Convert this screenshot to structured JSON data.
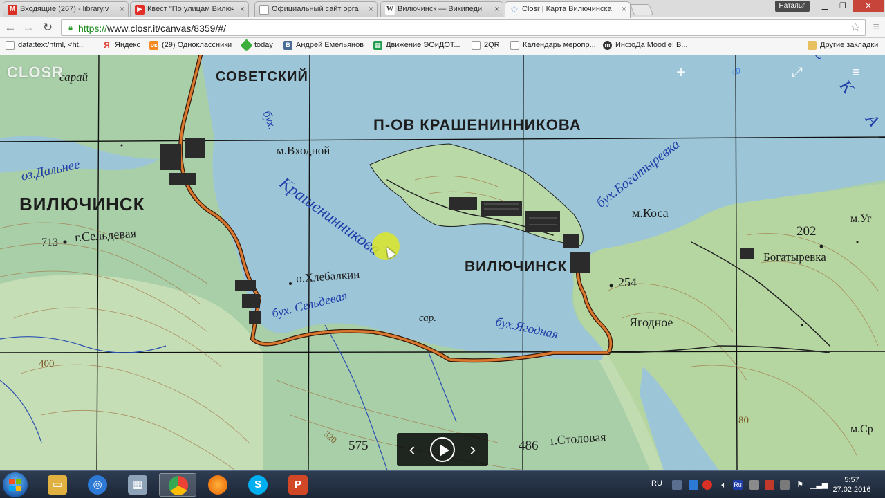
{
  "browser": {
    "tabs": [
      {
        "label": "Входящие (267) - library.v",
        "icon": "gmail-icon",
        "icon_color": "#d93025"
      },
      {
        "label": "Квест \"По улицам Вилюч",
        "icon": "youtube-icon",
        "icon_color": "#e52d27"
      },
      {
        "label": "Официальный сайт орга",
        "icon": "page-icon",
        "icon_color": "#888888"
      },
      {
        "label": "Вилючинск — Википеди",
        "icon": "wikipedia-icon",
        "icon_color": "#555555"
      },
      {
        "label": "Closr | Карта Вилючинска",
        "icon": "closr-star-icon",
        "icon_color": "#7aa7d8"
      }
    ],
    "user_name": "Наталья",
    "url_scheme": "https://",
    "url_rest": "www.closr.it/canvas/8359/#/",
    "bookmarks": [
      {
        "label": "data:text/html, <ht...",
        "icon": "page-icon",
        "color": "#888888"
      },
      {
        "label": "Яндекс",
        "icon": "yandex-icon",
        "color": "#e03b30"
      },
      {
        "label": "(29) Одноклассники",
        "icon": "odnoklassniki-icon",
        "color": "#f48a1f"
      },
      {
        "label": "today",
        "icon": "today-icon",
        "color": "#3cae3c"
      },
      {
        "label": "Андрей Емельянов",
        "icon": "vk-icon",
        "color": "#4a6d96"
      },
      {
        "label": "Движение ЭОиДОТ...",
        "icon": "sheets-icon",
        "color": "#1f9e4e"
      },
      {
        "label": "2QR",
        "icon": "page-icon",
        "color": "#888888"
      },
      {
        "label": "Календарь меропр...",
        "icon": "page-icon",
        "color": "#888888"
      },
      {
        "label": "ИнфоДа Moodle: В...",
        "icon": "moodle-icon",
        "color": "#333333"
      }
    ],
    "other_bookmarks": "Другие закладки"
  },
  "closr": {
    "logo": "CLOSR",
    "counter": "0"
  },
  "map_labels": {
    "sovetsky": "СОВЕТСКИЙ",
    "saray": "сарай",
    "peninsula": "П-ОВ КРАШЕНИННИКОВА",
    "m_vkhodnoy": "м.Входной",
    "oz_dalnee": "оз.Дальнее",
    "vilyuchinsk_w": "ВИЛЮЧИНСК",
    "elev_713": "713",
    "g_seldevaya": "г.Сельдевая",
    "bukh": "бух.",
    "krasheninnikova": "Крашенинникова",
    "vilyuchinsk_e": "ВИЛЮЧИНСК",
    "o_khlebalkin": "о.Хлебалкин",
    "bukh_seldevaya": "бух. Сельдевая",
    "sar": "сар.",
    "bukh_yagodnaya": "бух.Ягодная",
    "bukh_bogatyrevka": "бух.Богатыревка",
    "m_kosa": "м.Коса",
    "elev_202": "202",
    "m_ug": "м.Уг",
    "bogatyrevka": "Богатыревка",
    "elev_254": "254",
    "yagodnoe": "Ягодное",
    "elev_400": "400",
    "elev_575": "575",
    "elev_320": "320",
    "elev_486": "486",
    "g_stolovaya": "г.Столовая",
    "elev_80": "80",
    "m_sr": "м.Ср",
    "ska": "С К А"
  },
  "taskbar": {
    "apps": [
      {
        "name": "explorer-icon",
        "color": "#e0b040"
      },
      {
        "name": "media-player-icon",
        "color": "#2d7ad6"
      },
      {
        "name": "calculator-icon",
        "color": "#8fa3b8"
      },
      {
        "name": "chrome-icon",
        "color": "#34a853"
      },
      {
        "name": "firefox-icon",
        "color": "#e66000"
      },
      {
        "name": "skype-icon",
        "color": "#00aff0"
      },
      {
        "name": "powerpoint-icon",
        "color": "#d24726"
      }
    ],
    "lang": "RU",
    "time": "5:57",
    "date": "27.02.2016"
  }
}
